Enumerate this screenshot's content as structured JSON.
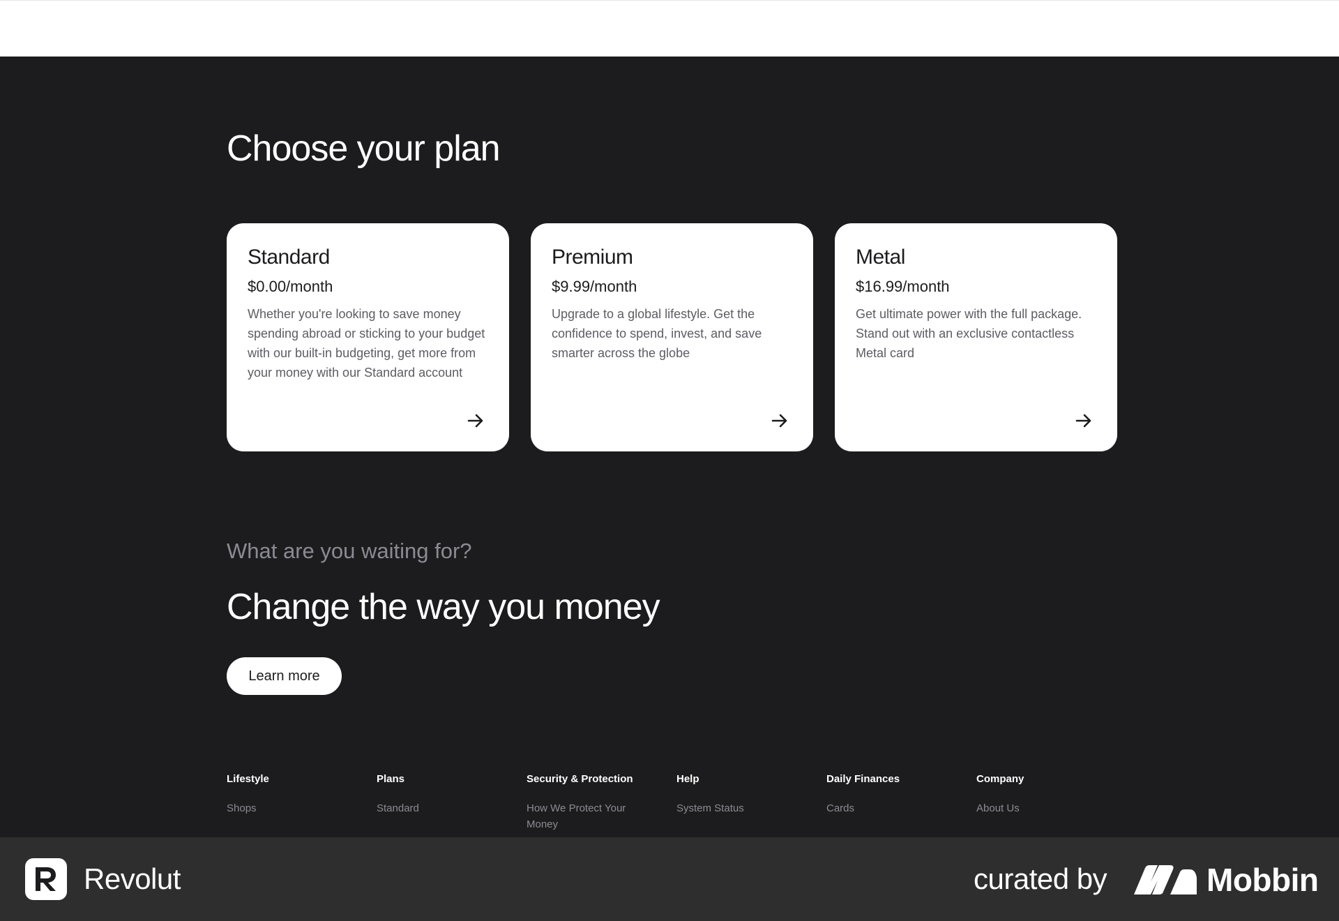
{
  "plans_section": {
    "title": "Choose your plan",
    "plans": [
      {
        "name": "Standard",
        "price": "$0.00/month",
        "description": "Whether you're looking to save money spending abroad or sticking to your budget with our built-in budgeting, get more from your money with our Standard account",
        "arrow_icon": "arrow-right-icon"
      },
      {
        "name": "Premium",
        "price": "$9.99/month",
        "description": "Upgrade to a global lifestyle. Get the confidence to spend, invest, and save smarter across the globe",
        "arrow_icon": "arrow-right-icon"
      },
      {
        "name": "Metal",
        "price": "$16.99/month",
        "description": "Get ultimate power with the full package. Stand out with an exclusive contactless Metal card",
        "arrow_icon": "arrow-right-icon"
      }
    ]
  },
  "cta": {
    "eyebrow": "What are you waiting for?",
    "title": "Change the way you money",
    "button_label": "Learn more"
  },
  "footer": {
    "columns": [
      {
        "heading": "Lifestyle",
        "links": [
          "Shops"
        ]
      },
      {
        "heading": "Plans",
        "links": [
          "Standard"
        ]
      },
      {
        "heading": "Security & Protection",
        "links": [
          "How We Protect Your Money"
        ]
      },
      {
        "heading": "Help",
        "links": [
          "System Status"
        ]
      },
      {
        "heading": "Daily Finances",
        "links": [
          "Cards"
        ]
      },
      {
        "heading": "Company",
        "links": [
          "About Us"
        ]
      }
    ]
  },
  "brand_bar": {
    "app_name": "Revolut",
    "curated_by": "curated by",
    "curator_name": "Mobbin",
    "app_logo_icon": "revolut-logo-icon",
    "curator_logo_icon": "mobbin-logo-icon"
  },
  "colors": {
    "page_background": "#1c1c1e",
    "card_background": "#ffffff",
    "muted_text": "#8b8b93",
    "brand_bar": "#2e2e2e"
  }
}
